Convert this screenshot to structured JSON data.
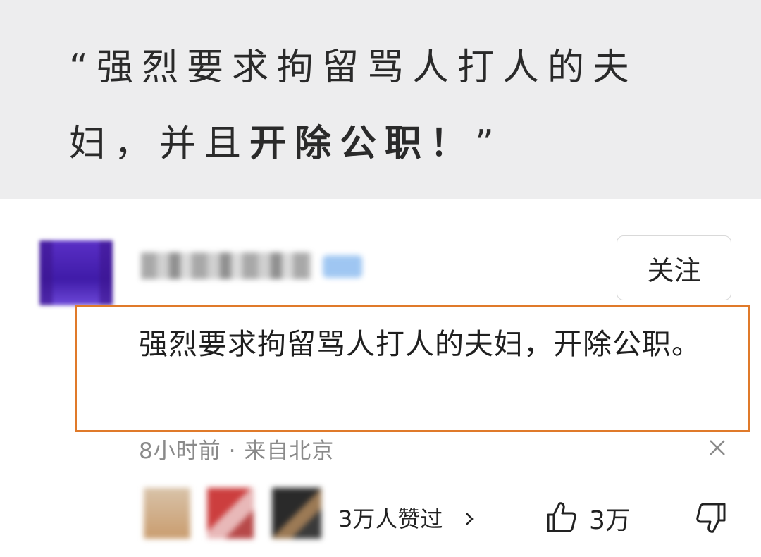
{
  "quote": {
    "open_mark": "“",
    "line1": "强烈要求拘留骂人打人的夫",
    "line2_lead": "妇，并且",
    "line2_bold": "开除公职！",
    "close_mark": "”"
  },
  "comment": {
    "follow_label": "关注",
    "text": "强烈要求拘留骂人打人的夫妇，开除公职。",
    "time": "8小时前",
    "separator": "·",
    "location": "来自北京",
    "likers_summary": "3万人赞过",
    "like_count": "3万"
  },
  "colors": {
    "highlight_border": "#e07a2a",
    "banner_bg": "#ededee",
    "meta_text": "#8a8a8a"
  },
  "icons": [
    "close-icon",
    "chevron-right-icon",
    "thumbs-up-icon",
    "thumbs-down-icon"
  ]
}
